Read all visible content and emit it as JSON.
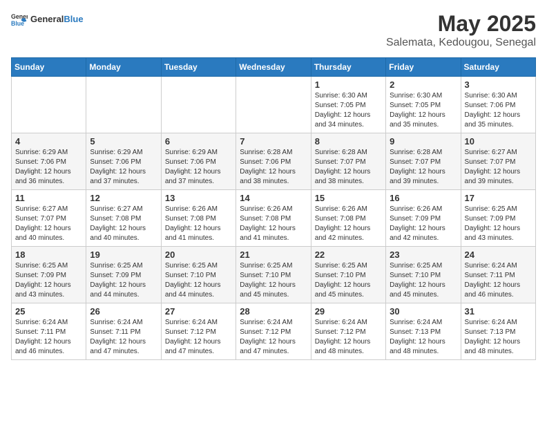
{
  "header": {
    "logo": {
      "general": "General",
      "blue": "Blue"
    },
    "title": "May 2025",
    "location": "Salemata, Kedougou, Senegal"
  },
  "calendar": {
    "weekdays": [
      "Sunday",
      "Monday",
      "Tuesday",
      "Wednesday",
      "Thursday",
      "Friday",
      "Saturday"
    ],
    "rows": [
      [
        {
          "day": "",
          "info": ""
        },
        {
          "day": "",
          "info": ""
        },
        {
          "day": "",
          "info": ""
        },
        {
          "day": "",
          "info": ""
        },
        {
          "day": "1",
          "info": "Sunrise: 6:30 AM\nSunset: 7:05 PM\nDaylight: 12 hours\nand 34 minutes."
        },
        {
          "day": "2",
          "info": "Sunrise: 6:30 AM\nSunset: 7:05 PM\nDaylight: 12 hours\nand 35 minutes."
        },
        {
          "day": "3",
          "info": "Sunrise: 6:30 AM\nSunset: 7:06 PM\nDaylight: 12 hours\nand 35 minutes."
        }
      ],
      [
        {
          "day": "4",
          "info": "Sunrise: 6:29 AM\nSunset: 7:06 PM\nDaylight: 12 hours\nand 36 minutes."
        },
        {
          "day": "5",
          "info": "Sunrise: 6:29 AM\nSunset: 7:06 PM\nDaylight: 12 hours\nand 37 minutes."
        },
        {
          "day": "6",
          "info": "Sunrise: 6:29 AM\nSunset: 7:06 PM\nDaylight: 12 hours\nand 37 minutes."
        },
        {
          "day": "7",
          "info": "Sunrise: 6:28 AM\nSunset: 7:06 PM\nDaylight: 12 hours\nand 38 minutes."
        },
        {
          "day": "8",
          "info": "Sunrise: 6:28 AM\nSunset: 7:07 PM\nDaylight: 12 hours\nand 38 minutes."
        },
        {
          "day": "9",
          "info": "Sunrise: 6:28 AM\nSunset: 7:07 PM\nDaylight: 12 hours\nand 39 minutes."
        },
        {
          "day": "10",
          "info": "Sunrise: 6:27 AM\nSunset: 7:07 PM\nDaylight: 12 hours\nand 39 minutes."
        }
      ],
      [
        {
          "day": "11",
          "info": "Sunrise: 6:27 AM\nSunset: 7:07 PM\nDaylight: 12 hours\nand 40 minutes."
        },
        {
          "day": "12",
          "info": "Sunrise: 6:27 AM\nSunset: 7:08 PM\nDaylight: 12 hours\nand 40 minutes."
        },
        {
          "day": "13",
          "info": "Sunrise: 6:26 AM\nSunset: 7:08 PM\nDaylight: 12 hours\nand 41 minutes."
        },
        {
          "day": "14",
          "info": "Sunrise: 6:26 AM\nSunset: 7:08 PM\nDaylight: 12 hours\nand 41 minutes."
        },
        {
          "day": "15",
          "info": "Sunrise: 6:26 AM\nSunset: 7:08 PM\nDaylight: 12 hours\nand 42 minutes."
        },
        {
          "day": "16",
          "info": "Sunrise: 6:26 AM\nSunset: 7:09 PM\nDaylight: 12 hours\nand 42 minutes."
        },
        {
          "day": "17",
          "info": "Sunrise: 6:25 AM\nSunset: 7:09 PM\nDaylight: 12 hours\nand 43 minutes."
        }
      ],
      [
        {
          "day": "18",
          "info": "Sunrise: 6:25 AM\nSunset: 7:09 PM\nDaylight: 12 hours\nand 43 minutes."
        },
        {
          "day": "19",
          "info": "Sunrise: 6:25 AM\nSunset: 7:09 PM\nDaylight: 12 hours\nand 44 minutes."
        },
        {
          "day": "20",
          "info": "Sunrise: 6:25 AM\nSunset: 7:10 PM\nDaylight: 12 hours\nand 44 minutes."
        },
        {
          "day": "21",
          "info": "Sunrise: 6:25 AM\nSunset: 7:10 PM\nDaylight: 12 hours\nand 45 minutes."
        },
        {
          "day": "22",
          "info": "Sunrise: 6:25 AM\nSunset: 7:10 PM\nDaylight: 12 hours\nand 45 minutes."
        },
        {
          "day": "23",
          "info": "Sunrise: 6:25 AM\nSunset: 7:10 PM\nDaylight: 12 hours\nand 45 minutes."
        },
        {
          "day": "24",
          "info": "Sunrise: 6:24 AM\nSunset: 7:11 PM\nDaylight: 12 hours\nand 46 minutes."
        }
      ],
      [
        {
          "day": "25",
          "info": "Sunrise: 6:24 AM\nSunset: 7:11 PM\nDaylight: 12 hours\nand 46 minutes."
        },
        {
          "day": "26",
          "info": "Sunrise: 6:24 AM\nSunset: 7:11 PM\nDaylight: 12 hours\nand 47 minutes."
        },
        {
          "day": "27",
          "info": "Sunrise: 6:24 AM\nSunset: 7:12 PM\nDaylight: 12 hours\nand 47 minutes."
        },
        {
          "day": "28",
          "info": "Sunrise: 6:24 AM\nSunset: 7:12 PM\nDaylight: 12 hours\nand 47 minutes."
        },
        {
          "day": "29",
          "info": "Sunrise: 6:24 AM\nSunset: 7:12 PM\nDaylight: 12 hours\nand 48 minutes."
        },
        {
          "day": "30",
          "info": "Sunrise: 6:24 AM\nSunset: 7:13 PM\nDaylight: 12 hours\nand 48 minutes."
        },
        {
          "day": "31",
          "info": "Sunrise: 6:24 AM\nSunset: 7:13 PM\nDaylight: 12 hours\nand 48 minutes."
        }
      ]
    ]
  }
}
